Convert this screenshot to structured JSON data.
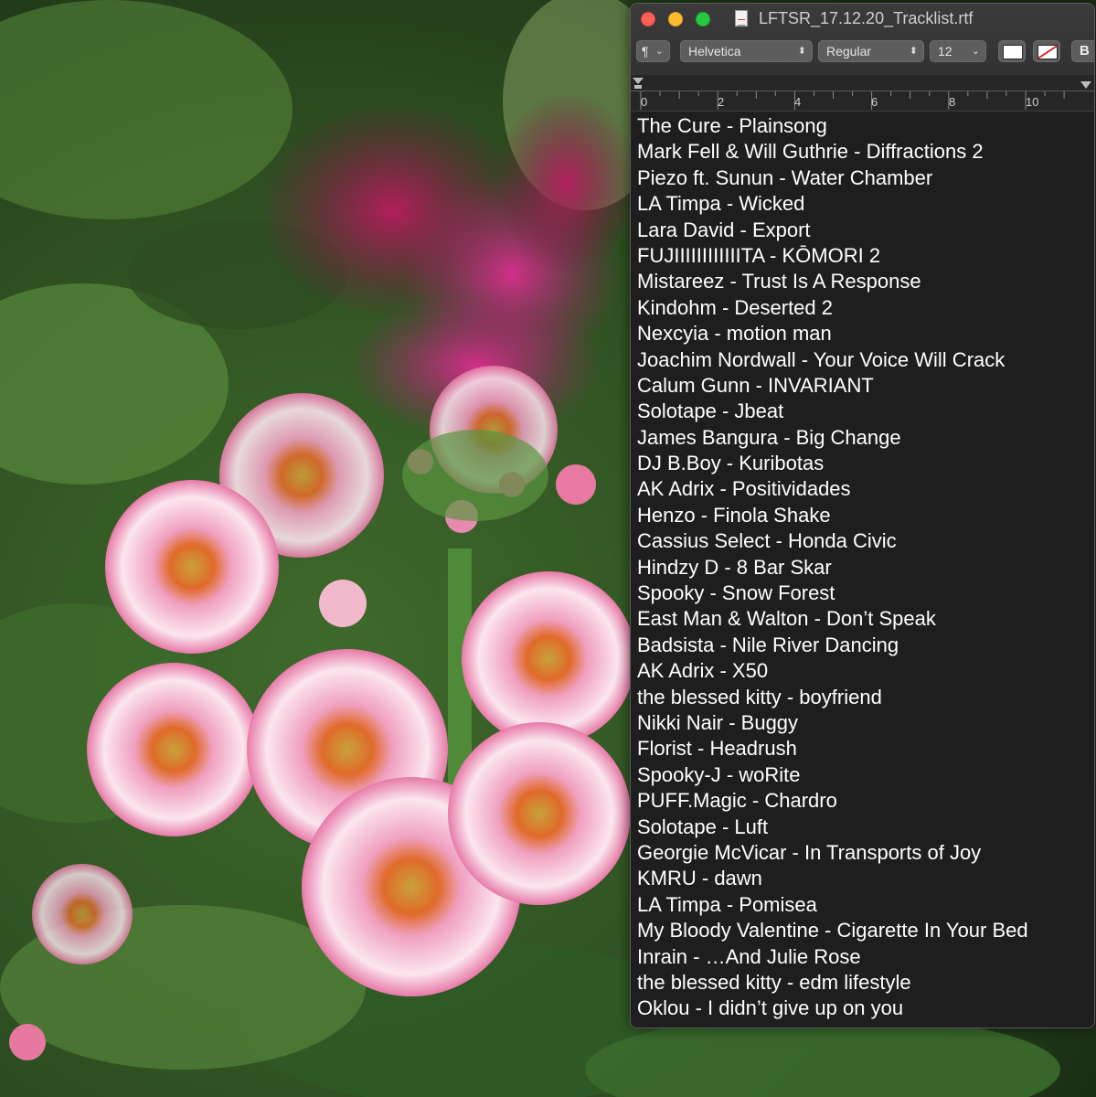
{
  "window": {
    "title": "LFTSR_17.12.20_Tracklist.rtf"
  },
  "toolbar": {
    "paragraph_style": "¶",
    "font_family": "Helvetica",
    "font_style": "Regular",
    "font_size": "12",
    "bold_label": "B",
    "text_color": "#ffffff"
  },
  "ruler": {
    "labels": [
      "0",
      "2",
      "4",
      "6",
      "8",
      "10"
    ]
  },
  "document": {
    "lines": [
      "The Cure - Plainsong",
      "Mark Fell & Will Guthrie - Diffractions 2",
      "Piezo ft. Sunun - Water Chamber",
      "LA Timpa - Wicked",
      "Lara David - Export",
      "FUJIIIIIIIIIIIITA - KŌMORI 2",
      "Mistareez - Trust Is A Response",
      "Kindohm - Deserted 2",
      "Nexcyia - motion man",
      "Joachim Nordwall - Your Voice Will Crack",
      "Calum Gunn - INVARIANT",
      "Solotape - Jbeat",
      "James Bangura - Big Change",
      "DJ B.Boy - Kuribotas",
      "AK Adrix - Positividades",
      "Henzo - Finola Shake",
      "Cassius Select - Honda Civic",
      "Hindzy D - 8 Bar Skar",
      "Spooky - Snow Forest",
      "East Man & Walton - Don’t Speak",
      "Badsista - Nile River Dancing",
      "AK Adrix - X50",
      "the blessed kitty - boyfriend",
      "Nikki Nair - Buggy",
      "Florist - Headrush",
      "Spooky-J - woRite",
      "PUFF.Magic - Chardro",
      "Solotape - Luft",
      "Georgie McVicar - In Transports of Joy",
      "KMRU - dawn",
      "LA Timpa - Pomisea",
      "My Bloody Valentine - Cigarette In Your Bed",
      "Inrain - …And Julie Rose",
      "the blessed kitty - edm lifestyle",
      "Oklou - I didn’t give up on you"
    ]
  },
  "colors": {
    "close": "#fe5f57",
    "minimize": "#febc2e",
    "zoom": "#28c840",
    "window_bg": "#1e1e1e"
  }
}
